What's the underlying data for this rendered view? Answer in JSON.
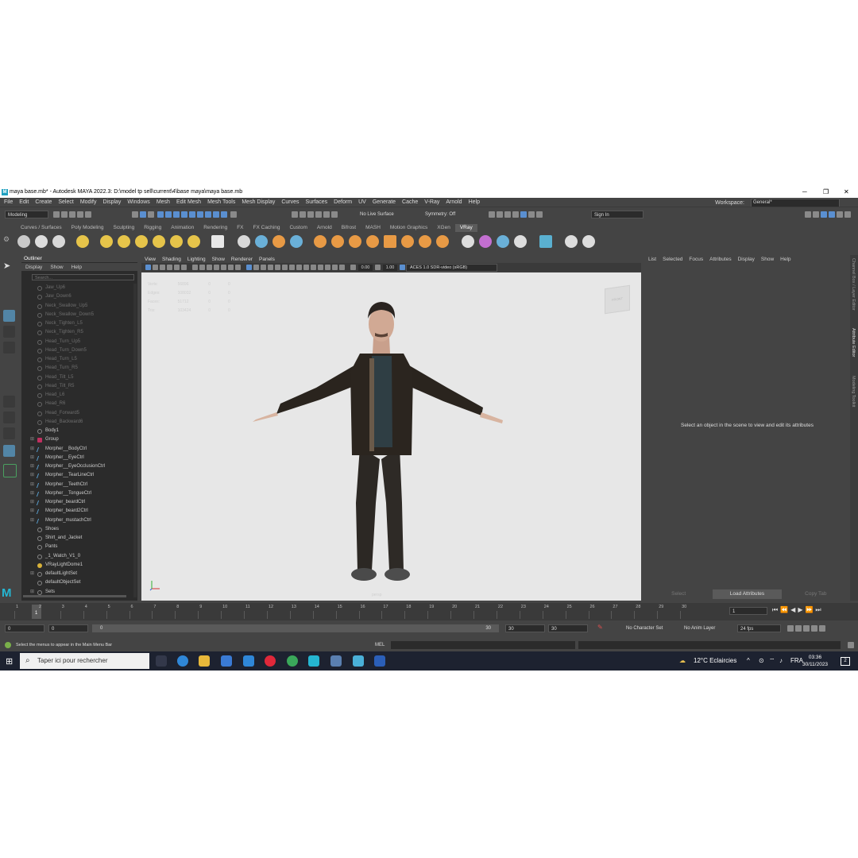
{
  "window": {
    "title": "maya base.mb* - Autodesk MAYA 2022.3: D:\\model tp sell\\current\\4\\base maya\\maya base.mb",
    "minimize": "─",
    "restore": "❐",
    "close": "✕"
  },
  "menubar": {
    "items": [
      "File",
      "Edit",
      "Create",
      "Select",
      "Modify",
      "Display",
      "Windows",
      "Mesh",
      "Edit Mesh",
      "Mesh Tools",
      "Mesh Display",
      "Curves",
      "Surfaces",
      "Deform",
      "UV",
      "Generate",
      "Cache",
      "V-Ray",
      "Arnold",
      "Help"
    ],
    "workspace_label": "Workspace:",
    "workspace_value": "General*"
  },
  "statusline": {
    "mode": "Modeling",
    "live_surface": "No Live Surface",
    "symmetry": "Symmetry: Off",
    "sign_in": "Sign In"
  },
  "shelf": {
    "tabs": [
      "Curves / Surfaces",
      "Poly Modeling",
      "Sculpting",
      "Rigging",
      "Animation",
      "Rendering",
      "FX",
      "FX Caching",
      "Custom",
      "Arnold",
      "Bifrost",
      "MASH",
      "Motion Graphics",
      "XGen",
      "VRay"
    ],
    "active_tab": "VRay"
  },
  "outliner": {
    "title": "Outliner",
    "menu": [
      "Display",
      "Show",
      "Help"
    ],
    "search_placeholder": "Search...",
    "items": [
      {
        "label": "Jaw_Up6",
        "dim": true,
        "exp": "",
        "icon": "joint"
      },
      {
        "label": "Jaw_Down6",
        "dim": true,
        "exp": "",
        "icon": "joint"
      },
      {
        "label": "Neck_Swallow_Up5",
        "dim": true,
        "exp": "",
        "icon": "joint"
      },
      {
        "label": "Neck_Swallow_Down5",
        "dim": true,
        "exp": "",
        "icon": "joint"
      },
      {
        "label": "Neck_Tighten_L5",
        "dim": true,
        "exp": "",
        "icon": "joint"
      },
      {
        "label": "Neck_Tighten_R5",
        "dim": true,
        "exp": "",
        "icon": "joint"
      },
      {
        "label": "Head_Turn_Up5",
        "dim": true,
        "exp": "",
        "icon": "joint"
      },
      {
        "label": "Head_Turn_Down5",
        "dim": true,
        "exp": "",
        "icon": "joint"
      },
      {
        "label": "Head_Turn_L5",
        "dim": true,
        "exp": "",
        "icon": "joint"
      },
      {
        "label": "Head_Turn_R5",
        "dim": true,
        "exp": "",
        "icon": "joint"
      },
      {
        "label": "Head_Tilt_L5",
        "dim": true,
        "exp": "",
        "icon": "joint"
      },
      {
        "label": "Head_Tilt_R5",
        "dim": true,
        "exp": "",
        "icon": "joint"
      },
      {
        "label": "Head_L6",
        "dim": true,
        "exp": "",
        "icon": "joint"
      },
      {
        "label": "Head_R6",
        "dim": true,
        "exp": "",
        "icon": "joint"
      },
      {
        "label": "Head_Forward5",
        "dim": true,
        "exp": "",
        "icon": "joint"
      },
      {
        "label": "Head_Backward6",
        "dim": true,
        "exp": "",
        "icon": "joint"
      },
      {
        "label": "Body1",
        "dim": false,
        "exp": "",
        "icon": "joint"
      },
      {
        "label": "Group",
        "dim": false,
        "exp": "⊞",
        "icon": "grp"
      },
      {
        "label": "Morpher__BodyCtrl",
        "dim": false,
        "exp": "⊞",
        "icon": "curve"
      },
      {
        "label": "Morpher__EyeCtrl",
        "dim": false,
        "exp": "⊞",
        "icon": "curve"
      },
      {
        "label": "Morpher__EyeOcclusionCtrl",
        "dim": false,
        "exp": "⊞",
        "icon": "curve"
      },
      {
        "label": "Morpher__TearLineCtrl",
        "dim": false,
        "exp": "⊞",
        "icon": "curve"
      },
      {
        "label": "Morpher__TeethCtrl",
        "dim": false,
        "exp": "⊞",
        "icon": "curve"
      },
      {
        "label": "Morpher__TongueCtrl",
        "dim": false,
        "exp": "⊞",
        "icon": "curve"
      },
      {
        "label": "Morpher_beardCtrl",
        "dim": false,
        "exp": "⊞",
        "icon": "curve"
      },
      {
        "label": "Morpher_beard2Ctrl",
        "dim": false,
        "exp": "⊞",
        "icon": "curve"
      },
      {
        "label": "Morpher_mustachCtrl",
        "dim": false,
        "exp": "⊞",
        "icon": "curve"
      },
      {
        "label": "Shoes",
        "dim": false,
        "exp": "",
        "icon": "joint"
      },
      {
        "label": "Shirt_and_Jacket",
        "dim": false,
        "exp": "",
        "icon": "joint"
      },
      {
        "label": "Pants",
        "dim": false,
        "exp": "",
        "icon": "joint"
      },
      {
        "label": "_1_Watch_V1_0",
        "dim": false,
        "exp": "",
        "icon": "joint"
      },
      {
        "label": "VRayLightDome1",
        "dim": false,
        "exp": "",
        "icon": "yel"
      },
      {
        "label": "defaultLightSet",
        "dim": false,
        "exp": "⊞",
        "icon": "set"
      },
      {
        "label": "defaultObjectSet",
        "dim": false,
        "exp": "",
        "icon": "set"
      },
      {
        "label": "Sets",
        "dim": false,
        "exp": "⊞",
        "icon": "set"
      }
    ]
  },
  "viewport": {
    "menu": [
      "View",
      "Shading",
      "Lighting",
      "Show",
      "Renderer",
      "Panels"
    ],
    "exposure": "0.00",
    "gamma": "1.00",
    "colorspace": "ACES 1.0 SDR-video (sRGB)",
    "hud": [
      [
        "Verts:",
        "56896",
        "0",
        "0"
      ],
      [
        "Edges:",
        "108032",
        "0",
        "0"
      ],
      [
        "Faces:",
        "51712",
        "0",
        "0"
      ],
      [
        "Tris:",
        "103424",
        "0",
        "0"
      ]
    ],
    "camera": "persp",
    "viewcube_label": "FRONT"
  },
  "attribute_editor": {
    "menu": [
      "List",
      "Selected",
      "Focus",
      "Attributes",
      "Display",
      "Show",
      "Help"
    ],
    "message": "Select an object in the scene to view and edit its attributes",
    "buttons": [
      "Select",
      "Load Attributes",
      "Copy Tab"
    ]
  },
  "side_tabs": [
    "Channel Box / Layer Editor",
    "Attribute Editor",
    "Modeling Toolkit"
  ],
  "timeline": {
    "ticks": [
      "1",
      "2",
      "3",
      "4",
      "5",
      "6",
      "7",
      "8",
      "9",
      "10",
      "11",
      "12",
      "13",
      "14",
      "15",
      "16",
      "17",
      "18",
      "19",
      "20",
      "21",
      "22",
      "23",
      "24",
      "25",
      "26",
      "27",
      "28",
      "29",
      "30"
    ],
    "current_frame": "1",
    "current_frame_field": "1",
    "play_controls": "⏮⏪◀▶⏩⏭"
  },
  "range": {
    "start": "0",
    "anim_start": "0",
    "slider_start": "0",
    "slider_end": "30",
    "anim_end": "30",
    "end": "30",
    "character_set": "No Character Set",
    "anim_layer": "No Anim Layer",
    "fps": "24 fps"
  },
  "commandline": {
    "help": "Select the menus to appear in the Main Menu Bar",
    "language": "MEL"
  },
  "taskbar": {
    "search_placeholder": "Taper ici pour rechercher",
    "weather": "12°C  Eclaircies",
    "lang": "FRA",
    "time": "03:36",
    "date": "30/11/2023",
    "notifications": "2"
  },
  "colors": {
    "maya_blue": "#25b6d2",
    "tool_active": "#5285a6",
    "panel": "#444444",
    "field": "#2b2b2b",
    "viewport_bg": "#e7e7e7"
  }
}
